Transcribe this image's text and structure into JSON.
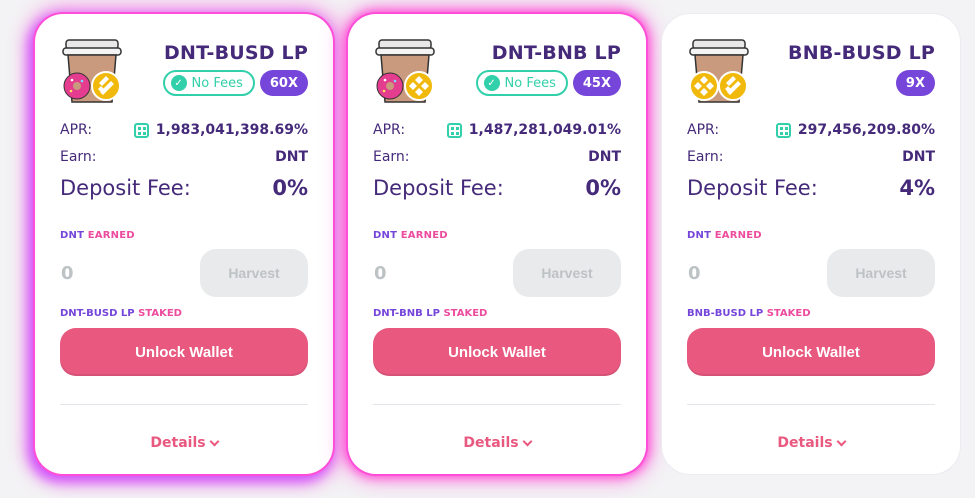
{
  "farms": [
    {
      "pair": "DNT-BUSD LP",
      "no_fees": "No Fees",
      "multiplier": "60X",
      "apr_label": "APR:",
      "apr": "1,983,041,398.69%",
      "earn_label": "Earn:",
      "earn": "DNT",
      "fee_label": "Deposit Fee:",
      "fee": "0%",
      "earned_token": "DNT",
      "earned_word": "EARNED",
      "earned_value": "0",
      "harvest": "Harvest",
      "staked_token": "DNT-BUSD LP",
      "staked_word": "STAKED",
      "unlock": "Unlock Wallet",
      "details": "Details",
      "tokens": [
        "donut-token-icon",
        "busd-token-icon"
      ]
    },
    {
      "pair": "DNT-BNB LP",
      "no_fees": "No Fees",
      "multiplier": "45X",
      "apr_label": "APR:",
      "apr": "1,487,281,049.01%",
      "earn_label": "Earn:",
      "earn": "DNT",
      "fee_label": "Deposit Fee:",
      "fee": "0%",
      "earned_token": "DNT",
      "earned_word": "EARNED",
      "earned_value": "0",
      "harvest": "Harvest",
      "staked_token": "DNT-BNB LP",
      "staked_word": "STAKED",
      "unlock": "Unlock Wallet",
      "details": "Details",
      "tokens": [
        "donut-token-icon",
        "bnb-token-icon"
      ]
    },
    {
      "pair": "BNB-BUSD LP",
      "multiplier": "9X",
      "apr_label": "APR:",
      "apr": "297,456,209.80%",
      "earn_label": "Earn:",
      "earn": "DNT",
      "fee_label": "Deposit Fee:",
      "fee": "4%",
      "earned_token": "DNT",
      "earned_word": "EARNED",
      "earned_value": "0",
      "harvest": "Harvest",
      "staked_token": "BNB-BUSD LP",
      "staked_word": "STAKED",
      "unlock": "Unlock Wallet",
      "details": "Details",
      "tokens": [
        "bnb-token-icon",
        "busd-token-icon"
      ]
    }
  ],
  "colors": {
    "purple_text": "#452a7a",
    "accent_purple": "#7645d9",
    "teal": "#31d0aa",
    "pink": "#e8587f",
    "glow": "#ff4fd8"
  }
}
